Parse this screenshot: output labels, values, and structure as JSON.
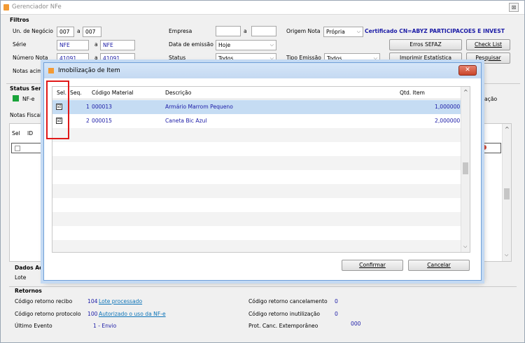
{
  "app": {
    "title": "Gerenciador NFe",
    "close": "⊠"
  },
  "filters": {
    "heading": "Filtros",
    "un_negocio": {
      "label": "Un. de Negócio",
      "from": "007",
      "sep": "a",
      "to": "007"
    },
    "serie": {
      "label": "Série",
      "from": "NFE",
      "sep": "a",
      "to": "NFE"
    },
    "numero_nota": {
      "label": "Número Nota",
      "from": "41091",
      "sep": "a",
      "to": "41091"
    },
    "notas_acima": {
      "label": "Notas acima"
    },
    "empresa": {
      "label": "Empresa",
      "from": "",
      "sep": "a",
      "to": ""
    },
    "data_emissao": {
      "label": "Data de emissão",
      "value": "Hoje"
    },
    "status": {
      "label": "Status",
      "value": "Todos"
    },
    "origem_nota": {
      "label": "Origem Nota",
      "value": "Própria"
    },
    "certificado": "Certificado CN=ABYZ PARTICIPACOES E INVEST",
    "tipo_emissao": {
      "label": "Tipo Emissão",
      "value": "Todos"
    }
  },
  "buttons": {
    "erros_sefaz": "Erros SEFAZ",
    "check_list": "Check List",
    "imprimir_estatistica": "Imprimir Estatística",
    "pesquisar": "Pesquisar"
  },
  "status_section": {
    "heading": "Status Ser",
    "nfe_label": "NF-e",
    "right_fragment": "ação"
  },
  "notas_fiscais": {
    "heading": "Notas Fiscais",
    "col_sel": "Sel",
    "col_id": "ID"
  },
  "dados": {
    "heading": "Dados Ad",
    "lote_label": "Lote"
  },
  "retornos": {
    "heading": "Retornos",
    "recibo_label": "Código retorno recibo",
    "recibo_code": "104",
    "recibo_link": "Lote processado",
    "protocolo_label": "Código retorno protocolo",
    "protocolo_code": "100",
    "protocolo_link": "Autorizado o uso da NF-e",
    "ultimo_evento_label": "Último Evento",
    "ultimo_evento_value": "1 - Envio",
    "cancelamento_label": "Código retorno cancelamento",
    "cancelamento_value": "0",
    "inutilizacao_label": "Código retorno inutilização",
    "inutilizacao_value": "0",
    "prot_canc_label": "Prot. Canc. Extemporâneo",
    "prot_canc_value": "000"
  },
  "modal": {
    "title": "Imobilização de Item",
    "close": "✕",
    "columns": {
      "sel": "Sel.",
      "seq": "Seq.",
      "codigo": "Código Material",
      "descricao": "Descrição",
      "qtd": "Qtd. Item"
    },
    "rows": [
      {
        "checked": "☑",
        "seq": "1",
        "codigo": "000013",
        "descricao": "Armário Marrom Pequeno",
        "qtd": "1,000000"
      },
      {
        "checked": "☑",
        "seq": "2",
        "codigo": "000015",
        "descricao": "Caneta Bic Azul",
        "qtd": "2,000000"
      }
    ],
    "confirmar": "Confirmar",
    "cancelar": "Cancelar"
  },
  "colors": {
    "accent": "#1a1aa6",
    "highlight_row": "#c5dcf3",
    "annotation": "#e01818",
    "nfe_status": "#19a33a"
  }
}
